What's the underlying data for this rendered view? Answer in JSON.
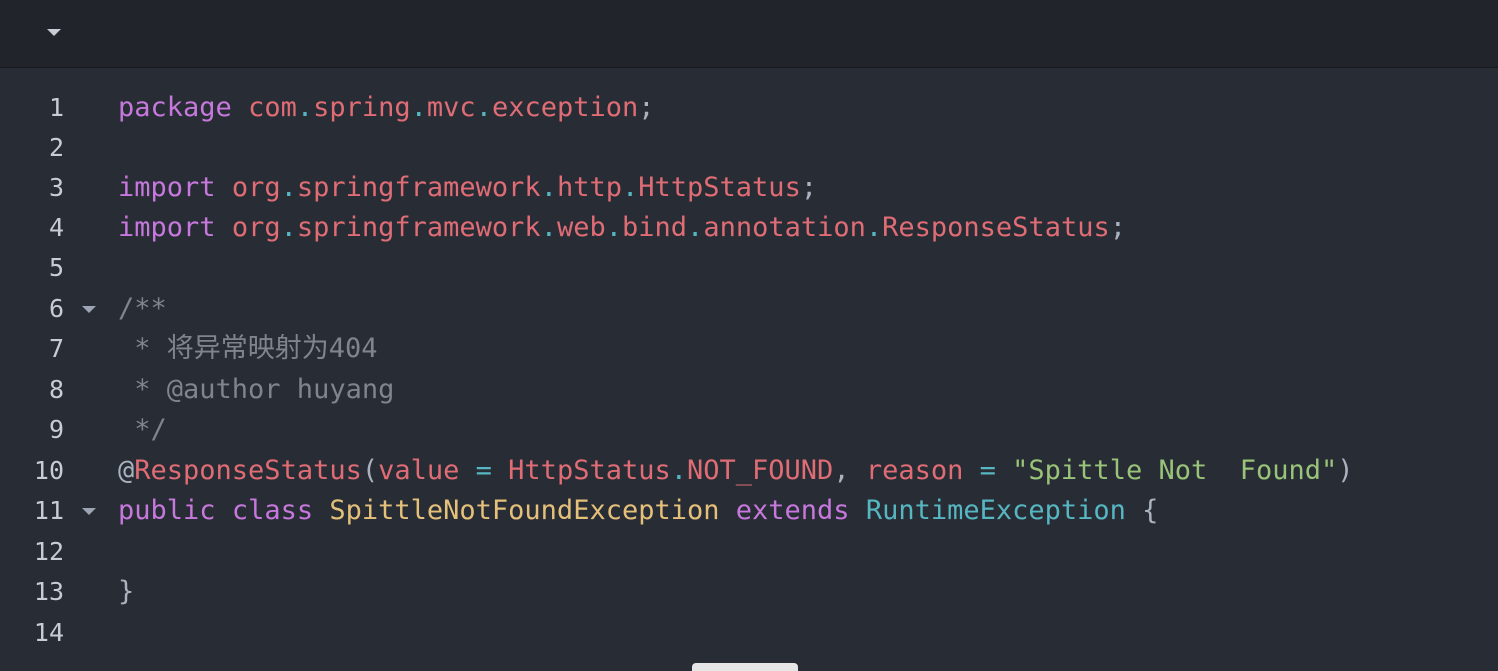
{
  "topbar": {
    "collapse_icon": "caret-down-icon"
  },
  "line_numbers": [
    "1",
    "2",
    "3",
    "4",
    "5",
    "6",
    "7",
    "8",
    "9",
    "10",
    "11",
    "12",
    "13",
    "14"
  ],
  "code": {
    "l1": {
      "kw": "package",
      "p1": "com",
      "d1": ".",
      "p2": "spring",
      "d2": ".",
      "p3": "mvc",
      "d3": ".",
      "p4": "exception",
      "end": ";"
    },
    "l3": {
      "kw": "import",
      "p1": "org",
      "d1": ".",
      "p2": "springframework",
      "d2": ".",
      "p3": "http",
      "d3": ".",
      "p4": "HttpStatus",
      "end": ";"
    },
    "l4": {
      "kw": "import",
      "p1": "org",
      "d1": ".",
      "p2": "springframework",
      "d2": ".",
      "p3": "web",
      "d3": ".",
      "p4": "bind",
      "d4": ".",
      "p5": "annotation",
      "d5": ".",
      "p6": "ResponseStatus",
      "end": ";"
    },
    "l6": "/**",
    "l7": " * 将异常映射为404",
    "l8": " * @author huyang",
    "l9": " */",
    "l10": {
      "at": "@",
      "ann": "ResponseStatus",
      "open": "(",
      "param1": "value",
      "eq1": " = ",
      "cls": "HttpStatus",
      "dot": ".",
      "const": "NOT_FOUND",
      "comma": ", ",
      "param2": "reason",
      "eq2": " = ",
      "str": "\"Spittle Not  Found\"",
      "close": ")"
    },
    "l11": {
      "kw1": "public",
      "sp1": " ",
      "kw2": "class",
      "sp2": " ",
      "cls": "SpittleNotFoundException",
      "sp3": " ",
      "kw3": "extends",
      "sp4": " ",
      "type": "RuntimeException",
      "brace": " {"
    },
    "l13": "}"
  },
  "colors": {
    "background": "#282c34",
    "keyword": "#c678dd",
    "package": "#e06c75",
    "dot": "#56b6c2",
    "comment": "#7f848e",
    "string": "#98c379",
    "class": "#e5c07b",
    "type": "#56b6c2"
  }
}
